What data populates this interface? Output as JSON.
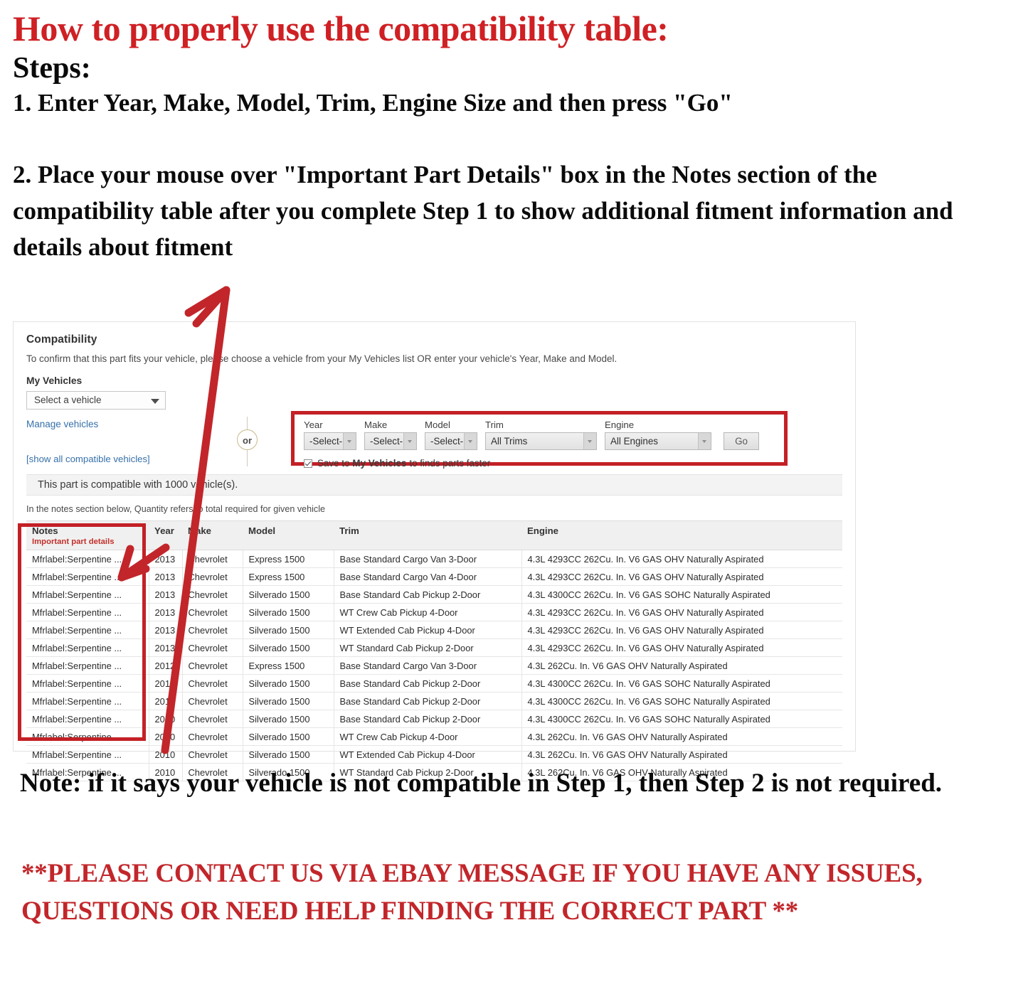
{
  "headline": {
    "title": "How to properly use the compatibility table:",
    "steps_label": "Steps:",
    "step_one": "1. Enter Year, Make, Model, Trim, Engine Size and then press \"Go\"",
    "step_two": "2. Place your mouse over \"Important Part Details\" box in the Notes section of the compatibility table after you complete Step 1 to show additional fitment information and details about fitment"
  },
  "compat": {
    "title": "Compatibility",
    "subtitle": "To confirm that this part fits your vehicle, please choose a vehicle from your My Vehicles list OR enter your vehicle's Year, Make and Model.",
    "my_vehicles_label": "My Vehicles",
    "my_vehicles_value": "Select a vehicle",
    "manage_link": "Manage vehicles",
    "show_all_link": "[show all compatible vehicles]",
    "or_label": "or",
    "banner": "This part is compatible with 1000 vehicle(s).",
    "qty_note": "In the notes section below, Quantity refers to total required for given vehicle",
    "finder": {
      "year_label": "Year",
      "year_value": "-Select-",
      "make_label": "Make",
      "make_value": "-Select-",
      "model_label": "Model",
      "model_value": "-Select-",
      "trim_label": "Trim",
      "trim_value": "All Trims",
      "engine_label": "Engine",
      "engine_value": "All Engines",
      "go_label": "Go",
      "save_prefix": "Save to",
      "save_bold": "My Vehicles",
      "save_suffix": "to finds parts faster"
    }
  },
  "table": {
    "headers": {
      "notes": "Notes",
      "notes_sub": "Important part details",
      "year": "Year",
      "make": "Make",
      "model": "Model",
      "trim": "Trim",
      "engine": "Engine"
    },
    "rows": [
      {
        "notes": "Mfrlabel:Serpentine ...",
        "year": "2013",
        "make": "Chevrolet",
        "model": "Express 1500",
        "trim": "Base Standard Cargo Van 3-Door",
        "engine": "4.3L 4293CC 262Cu. In. V6 GAS OHV Naturally Aspirated"
      },
      {
        "notes": "Mfrlabel:Serpentine ...",
        "year": "2013",
        "make": "Chevrolet",
        "model": "Express 1500",
        "trim": "Base Standard Cargo Van 4-Door",
        "engine": "4.3L 4293CC 262Cu. In. V6 GAS OHV Naturally Aspirated"
      },
      {
        "notes": "Mfrlabel:Serpentine ...",
        "year": "2013",
        "make": "Chevrolet",
        "model": "Silverado 1500",
        "trim": "Base Standard Cab Pickup 2-Door",
        "engine": "4.3L 4300CC 262Cu. In. V6 GAS SOHC Naturally Aspirated"
      },
      {
        "notes": "Mfrlabel:Serpentine ...",
        "year": "2013",
        "make": "Chevrolet",
        "model": "Silverado 1500",
        "trim": "WT Crew Cab Pickup 4-Door",
        "engine": "4.3L 4293CC 262Cu. In. V6 GAS OHV Naturally Aspirated"
      },
      {
        "notes": "Mfrlabel:Serpentine ...",
        "year": "2013",
        "make": "Chevrolet",
        "model": "Silverado 1500",
        "trim": "WT Extended Cab Pickup 4-Door",
        "engine": "4.3L 4293CC 262Cu. In. V6 GAS OHV Naturally Aspirated"
      },
      {
        "notes": "Mfrlabel:Serpentine ...",
        "year": "2013",
        "make": "Chevrolet",
        "model": "Silverado 1500",
        "trim": "WT Standard Cab Pickup 2-Door",
        "engine": "4.3L 4293CC 262Cu. In. V6 GAS OHV Naturally Aspirated"
      },
      {
        "notes": "Mfrlabel:Serpentine ...",
        "year": "2012",
        "make": "Chevrolet",
        "model": "Express 1500",
        "trim": "Base Standard Cargo Van 3-Door",
        "engine": "4.3L 262Cu. In. V6 GAS OHV Naturally Aspirated"
      },
      {
        "notes": "Mfrlabel:Serpentine ...",
        "year": "2012",
        "make": "Chevrolet",
        "model": "Silverado 1500",
        "trim": "Base Standard Cab Pickup 2-Door",
        "engine": "4.3L 4300CC 262Cu. In. V6 GAS SOHC Naturally Aspirated"
      },
      {
        "notes": "Mfrlabel:Serpentine ...",
        "year": "2011",
        "make": "Chevrolet",
        "model": "Silverado 1500",
        "trim": "Base Standard Cab Pickup 2-Door",
        "engine": "4.3L 4300CC 262Cu. In. V6 GAS SOHC Naturally Aspirated"
      },
      {
        "notes": "Mfrlabel:Serpentine ...",
        "year": "2010",
        "make": "Chevrolet",
        "model": "Silverado 1500",
        "trim": "Base Standard Cab Pickup 2-Door",
        "engine": "4.3L 4300CC 262Cu. In. V6 GAS SOHC Naturally Aspirated"
      },
      {
        "notes": "Mfrlabel:Serpentine ...",
        "year": "2010",
        "make": "Chevrolet",
        "model": "Silverado 1500",
        "trim": "WT Crew Cab Pickup 4-Door",
        "engine": "4.3L 262Cu. In. V6 GAS OHV Naturally Aspirated"
      },
      {
        "notes": "Mfrlabel:Serpentine ...",
        "year": "2010",
        "make": "Chevrolet",
        "model": "Silverado 1500",
        "trim": "WT Extended Cab Pickup 4-Door",
        "engine": "4.3L 262Cu. In. V6 GAS OHV Naturally Aspirated"
      },
      {
        "notes": "Mfrlabel:Serpentine ...",
        "year": "2010",
        "make": "Chevrolet",
        "model": "Silverado 1500",
        "trim": "WT Standard Cab Pickup 2-Door",
        "engine": "4.3L 262Cu. In. V6 GAS OHV Naturally Aspirated"
      }
    ]
  },
  "footer": {
    "note": "Note: if it says your vehicle is not compatible in Step 1, then Step 2 is not required.",
    "contact": "**PLEASE CONTACT US VIA EBAY MESSAGE IF YOU HAVE ANY ISSUES, QUESTIONS OR NEED HELP FINDING THE CORRECT PART **"
  },
  "colors": {
    "red_accent": "#cf2024",
    "red_box": "#c32026",
    "link_blue": "#3670a9",
    "body_text": "#0a0a0a"
  }
}
